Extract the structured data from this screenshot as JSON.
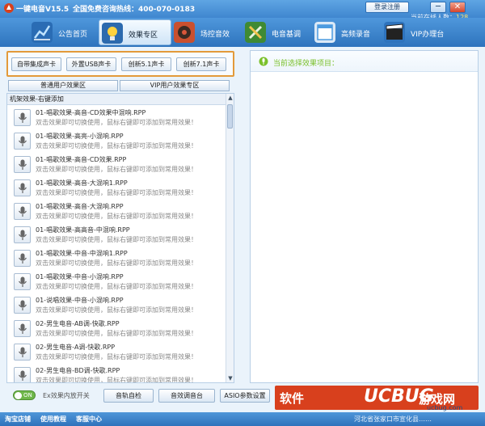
{
  "window": {
    "title": "一键电音V15.5",
    "hotline": "全国免费咨询热线：400-070-0183",
    "login_label": "登录注册",
    "minimize": "─",
    "close": "✕",
    "online_label": "当前在线人数：",
    "online_count": "128"
  },
  "nav": [
    {
      "label": "公告首页",
      "icon": "chart-icon",
      "color": "#3b8bd6"
    },
    {
      "label": "效果专区",
      "icon": "lightbulb-icon",
      "color": "#f2b01e",
      "active": true
    },
    {
      "label": "场控音效",
      "icon": "speaker-icon",
      "color": "#d9573a"
    },
    {
      "label": "电音基调",
      "icon": "wrench-icon",
      "color": "#5ab04a"
    },
    {
      "label": "高频录音",
      "icon": "window-icon",
      "color": "#4c9be0"
    },
    {
      "label": "VIP办理台",
      "icon": "clapper-icon",
      "color": "#333333"
    }
  ],
  "sound_cards": [
    "自带集成声卡",
    "外置USB声卡",
    "创新5.1声卡",
    "创新7.1声卡"
  ],
  "tabs": [
    "普通用户效果区",
    "VIP用户效果专区"
  ],
  "right_panel": {
    "title": "当前选择效果项目："
  },
  "list": {
    "header": "机架效果-右键添加",
    "scroll_up": "▲",
    "scroll_down": "▼",
    "desc": "双击效果即可切换使用，鼠标右键即可添加到常用效果！",
    "items": [
      "01-唱歌效果-高音-CD效果中混响.RPP",
      "01-唱歌效果-高亮-小混响.RPP",
      "01-唱歌效果-高音-CD效果.RPP",
      "01-唱歌效果-高音-大混响1.RPP",
      "01-唱歌效果-高音-大混响.RPP",
      "01-唱歌效果-高高音-中混响.RPP",
      "01-唱歌效果-中音-中混响1.RPP",
      "01-唱歌效果-中音-小混响.RPP",
      "01-说唱效果-中音-小混响.RPP",
      "02-男生电音-AB调-快歌.RPP",
      "02-男生电音-A调-快歌.RPP",
      "02-男生电音-BD调-快歌.RPP"
    ]
  },
  "bottom": {
    "toggle_state": "ON",
    "toggle_label": "Ex效果内放开关",
    "buttons": [
      "音轨自检",
      "音效调音台",
      "ASIO参数设置"
    ]
  },
  "banner": {
    "left": "软件",
    "bug": "UCBUG",
    "right": "游戏网"
  },
  "status": {
    "links": [
      "淘宝店铺",
      "使用教程",
      "客服中心"
    ],
    "address": "河北省张家口市宣化县……",
    "watermark": "ucbug.com"
  }
}
